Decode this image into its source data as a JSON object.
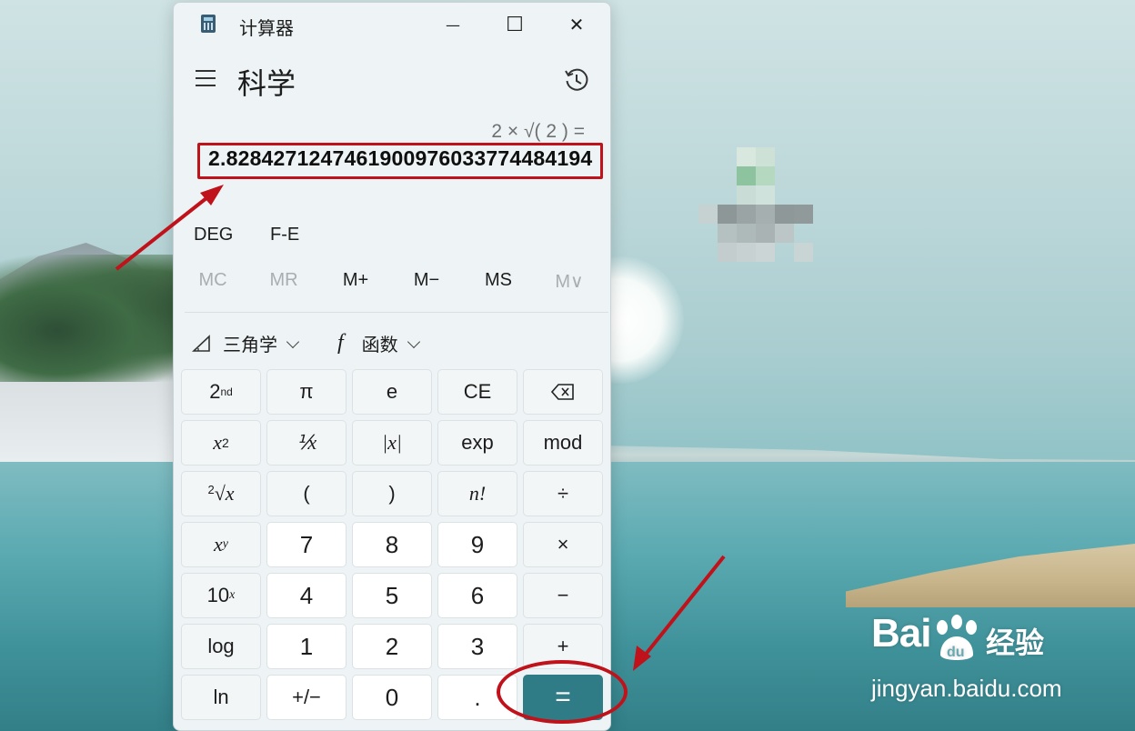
{
  "window": {
    "app_title": "计算器",
    "minimize_glyph": "—",
    "maximize_glyph": "☐",
    "close_glyph": "✕"
  },
  "header": {
    "mode_title": "科学",
    "menu_icon": "hamburger-icon",
    "history_icon": "history-icon"
  },
  "display": {
    "expression": "2 × √( 2 ) =",
    "result": "2.8284271247461900976033774484194"
  },
  "angle_row": {
    "deg_label": "DEG",
    "fe_label": "F-E"
  },
  "memory_row": [
    {
      "label": "MC",
      "enabled": false
    },
    {
      "label": "MR",
      "enabled": false
    },
    {
      "label": "M+",
      "enabled": true
    },
    {
      "label": "M−",
      "enabled": true
    },
    {
      "label": "MS",
      "enabled": true
    },
    {
      "label": "M∨",
      "enabled": false
    }
  ],
  "function_row": {
    "trig_label": "三角学",
    "func_glyph": "f",
    "func_label": "函数"
  },
  "keys": {
    "second": {
      "base": "2",
      "sup": "nd"
    },
    "pi": "π",
    "e": "e",
    "ce": "CE",
    "backspace": "backspace-icon",
    "x_squared": {
      "base": "x",
      "sup": "2"
    },
    "reciprocal": "⅟x",
    "abs": "|x|",
    "exp": "exp",
    "mod": "mod",
    "root": {
      "sup": "2",
      "base": "√x"
    },
    "lparen": "(",
    "rparen": ")",
    "factorial": "n!",
    "divide": "÷",
    "x_pow_y": {
      "base": "x",
      "sup": "y"
    },
    "seven": "7",
    "eight": "8",
    "nine": "9",
    "multiply": "×",
    "ten_pow_x": {
      "base": "10",
      "sup": "x"
    },
    "four": "4",
    "five": "5",
    "six": "6",
    "minus": "−",
    "log": "log",
    "one": "1",
    "two": "2",
    "three": "3",
    "plus": "+",
    "ln": "ln",
    "negate": "+/−",
    "zero": "0",
    "decimal": ".",
    "equals": "="
  },
  "watermark": {
    "logo_text": "Bai",
    "logo_text_2": "du",
    "cn_text": "经验",
    "url": "jingyan.baidu.com"
  },
  "colors": {
    "accent": "#2f7c86",
    "annotation_red": "#c0121a",
    "window_bg": "#eef4f5"
  }
}
